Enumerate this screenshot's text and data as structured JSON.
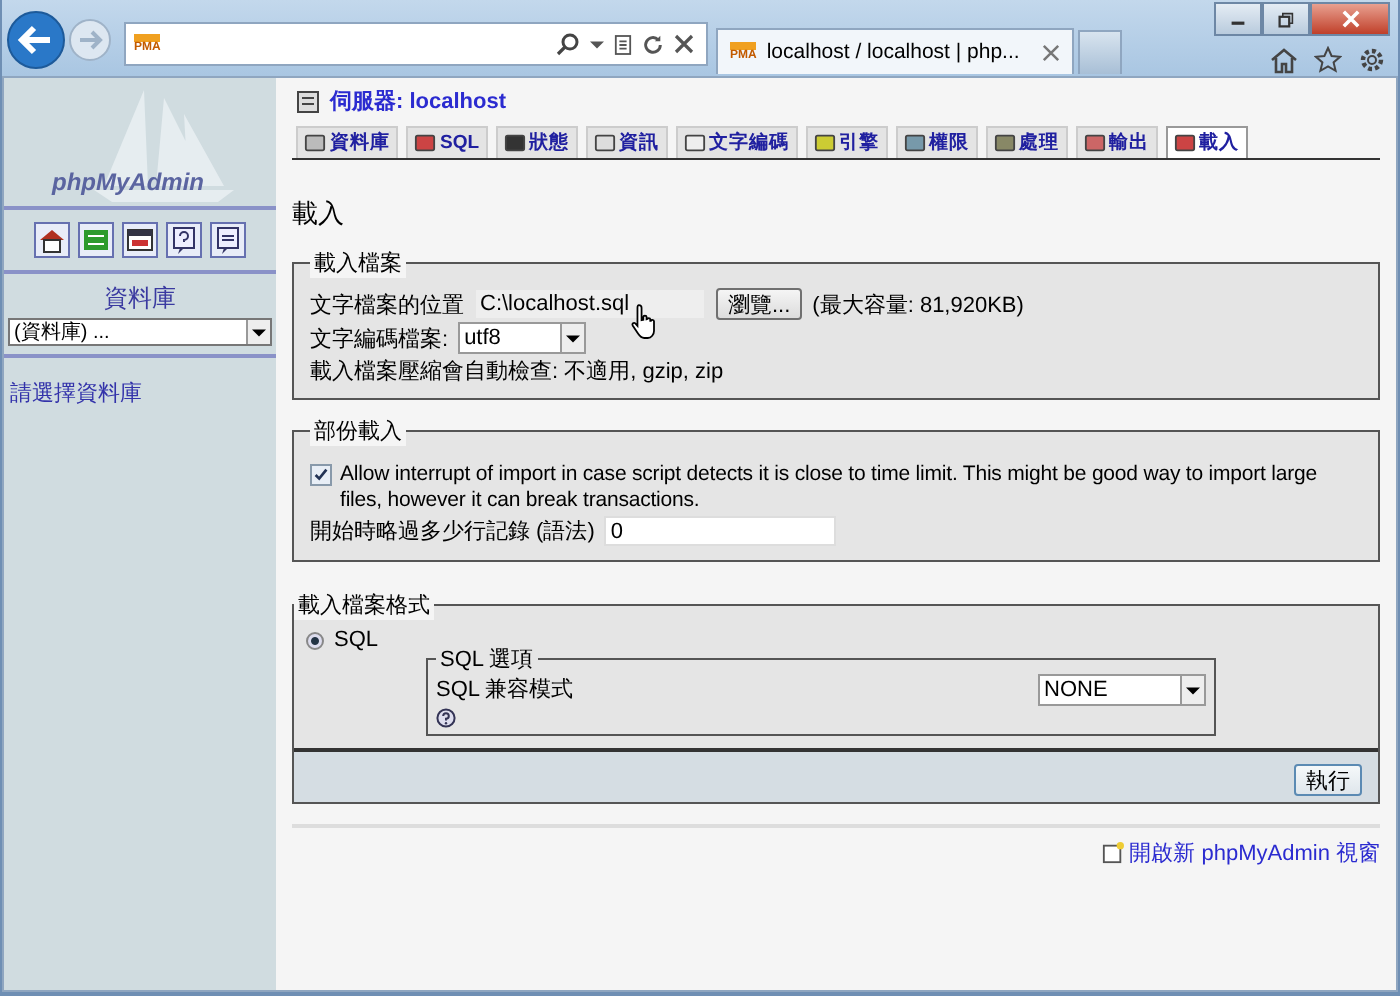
{
  "browser": {
    "address_favicon": "PMA",
    "tab_favicon": "PMA",
    "tab_title": "localhost / localhost | php..."
  },
  "sidebar": {
    "logo": "phpMyAdmin",
    "database_label": "資料庫",
    "database_select": "(資料庫) ...",
    "hint": "請選擇資料庫"
  },
  "server": {
    "label": "伺服器: localhost"
  },
  "tabs": [
    {
      "label": "資料庫",
      "selected": false
    },
    {
      "label": "SQL",
      "selected": false
    },
    {
      "label": "狀態",
      "selected": false
    },
    {
      "label": "資訊",
      "selected": false
    },
    {
      "label": "文字編碼",
      "selected": false
    },
    {
      "label": "引擎",
      "selected": false
    },
    {
      "label": "權限",
      "selected": false
    },
    {
      "label": "處理",
      "selected": false
    },
    {
      "label": "輸出",
      "selected": false
    },
    {
      "label": "載入",
      "selected": true
    }
  ],
  "heading": "載入",
  "file_section": {
    "legend": "載入檔案",
    "location_label": "文字檔案的位置",
    "location_value": "C:\\localhost.sql",
    "browse_button": "瀏覽...",
    "max_size": "(最大容量: 81,920KB)",
    "charset_label": "文字編碼檔案:",
    "charset_value": "utf8",
    "compression_note": "載入檔案壓縮會自動檢查: 不適用, gzip, zip"
  },
  "partial_section": {
    "legend": "部份載入",
    "allow_interrupt": {
      "checked": true,
      "label": "Allow interrupt of import in case script detects it is close to time limit. This might be good way to import large files, however it can break transactions."
    },
    "skip_label": "開始時略過多少行記錄 (語法)",
    "skip_value": "0"
  },
  "format_section": {
    "legend": "載入檔案格式",
    "formats": [
      {
        "label": "SQL",
        "selected": true
      }
    ],
    "options_legend": "SQL 選項",
    "compat_label": "SQL 兼容模式",
    "compat_value": "NONE",
    "go_button": "執行"
  },
  "footer_link": "開啟新 phpMyAdmin 視窗"
}
